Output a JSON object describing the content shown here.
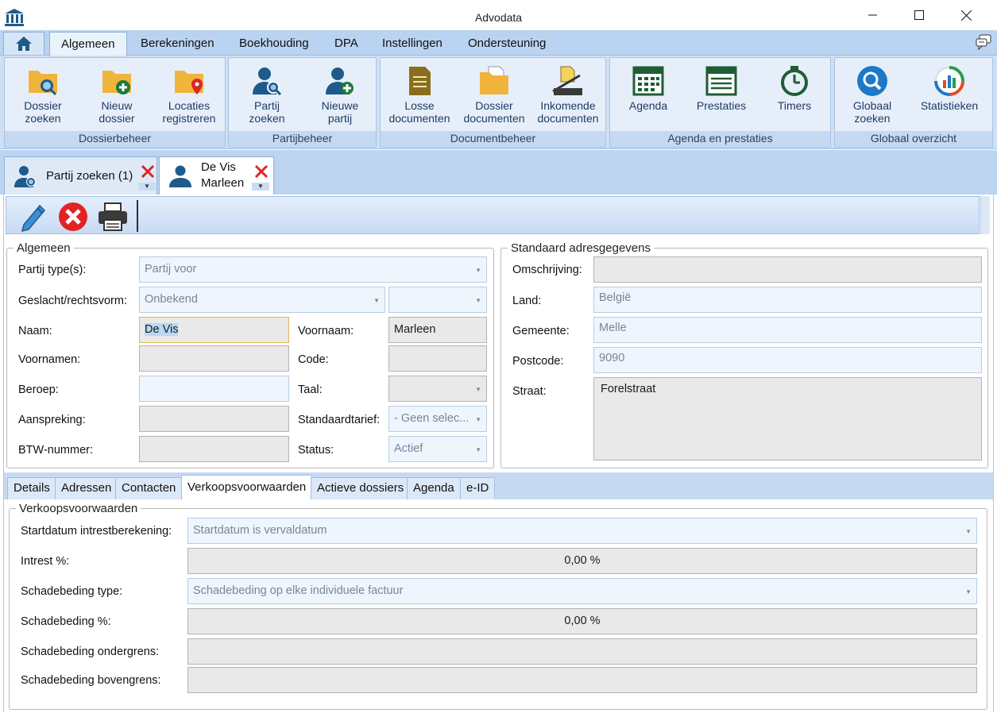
{
  "window": {
    "title": "Advodata"
  },
  "menu": {
    "tabs": [
      "Algemeen",
      "Berekeningen",
      "Boekhouding",
      "DPA",
      "Instellingen",
      "Ondersteuning"
    ]
  },
  "ribbon": {
    "groups": [
      {
        "label": "Dossierbeheer",
        "buttons": [
          {
            "line1": "Dossier",
            "line2": "zoeken"
          },
          {
            "line1": "Nieuw",
            "line2": "dossier"
          },
          {
            "line1": "Locaties",
            "line2": "registreren"
          }
        ]
      },
      {
        "label": "Partijbeheer",
        "buttons": [
          {
            "line1": "Partij",
            "line2": "zoeken"
          },
          {
            "line1": "Nieuwe",
            "line2": "partij"
          }
        ]
      },
      {
        "label": "Documentbeheer",
        "buttons": [
          {
            "line1": "Losse",
            "line2": "documenten"
          },
          {
            "line1": "Dossier",
            "line2": "documenten"
          },
          {
            "line1": "Inkomende",
            "line2": "documenten"
          }
        ]
      },
      {
        "label": "Agenda en prestaties",
        "buttons": [
          {
            "line1": "Agenda",
            "line2": ""
          },
          {
            "line1": "Prestaties",
            "line2": ""
          },
          {
            "line1": "Timers",
            "line2": ""
          }
        ]
      },
      {
        "label": "Globaal overzicht",
        "buttons": [
          {
            "line1": "Globaal",
            "line2": "zoeken"
          },
          {
            "line1": "Statistieken",
            "line2": ""
          }
        ]
      }
    ]
  },
  "doc_tabs": [
    {
      "line1": "Partij zoeken (1)",
      "line2": ""
    },
    {
      "line1": "De Vis",
      "line2": "Marleen"
    }
  ],
  "algemeen": {
    "legend": "Algemeen",
    "partij_types_label": "Partij type(s):",
    "partij_types_value": "Partij voor",
    "geslacht_label": "Geslacht/rechtsvorm:",
    "geslacht_value": "Onbekend",
    "geslacht_extra_value": "",
    "naam_label": "Naam:",
    "naam_value": "De Vis",
    "voornaam_label": "Voornaam:",
    "voornaam_value": "Marleen",
    "voornamen_label": "Voornamen:",
    "voornamen_value": "",
    "code_label": "Code:",
    "code_value": "",
    "beroep_label": "Beroep:",
    "beroep_value": "",
    "taal_label": "Taal:",
    "taal_value": "",
    "aanspreking_label": "Aanspreking:",
    "aanspreking_value": "",
    "standaardtarief_label": "Standaardtarief:",
    "standaardtarief_value": "- Geen selec...",
    "btw_label": "BTW-nummer:",
    "btw_value": "",
    "status_label": "Status:",
    "status_value": "Actief"
  },
  "adres": {
    "legend": "Standaard adresgegevens",
    "omschrijving_label": "Omschrijving:",
    "omschrijving_value": "",
    "land_label": "Land:",
    "land_value": "België",
    "gemeente_label": "Gemeente:",
    "gemeente_value": "Melle",
    "postcode_label": "Postcode:",
    "postcode_value": "9090",
    "straat_label": "Straat:",
    "straat_value": "Forelstraat"
  },
  "bottom_tabs": [
    "Details",
    "Adressen",
    "Contacten",
    "Verkoopsvoorwaarden",
    "Actieve dossiers",
    "Agenda",
    "e-ID"
  ],
  "verkoop": {
    "legend": "Verkoopsvoorwaarden",
    "startdatum_label": "Startdatum intrestberekening:",
    "startdatum_value": "Startdatum is vervaldatum",
    "intrest_label": "Intrest %:",
    "intrest_value": "0,00 %",
    "schade_type_label": "Schadebeding type:",
    "schade_type_value": "Schadebeding op elke individuele factuur",
    "schade_pct_label": "Schadebeding %:",
    "schade_pct_value": "0,00 %",
    "schade_onder_label": "Schadebeding ondergrens:",
    "schade_onder_value": "",
    "schade_boven_label": "Schadebeding bovengrens:",
    "schade_boven_value": ""
  },
  "colors": {
    "ribbon_bg": "#cfe0f5",
    "group_bg": "#e6eff9",
    "icon_blue": "#1f5a8c",
    "icon_orange": "#f0b43c",
    "icon_green": "#1e7a3c",
    "close_red": "#e02424"
  }
}
